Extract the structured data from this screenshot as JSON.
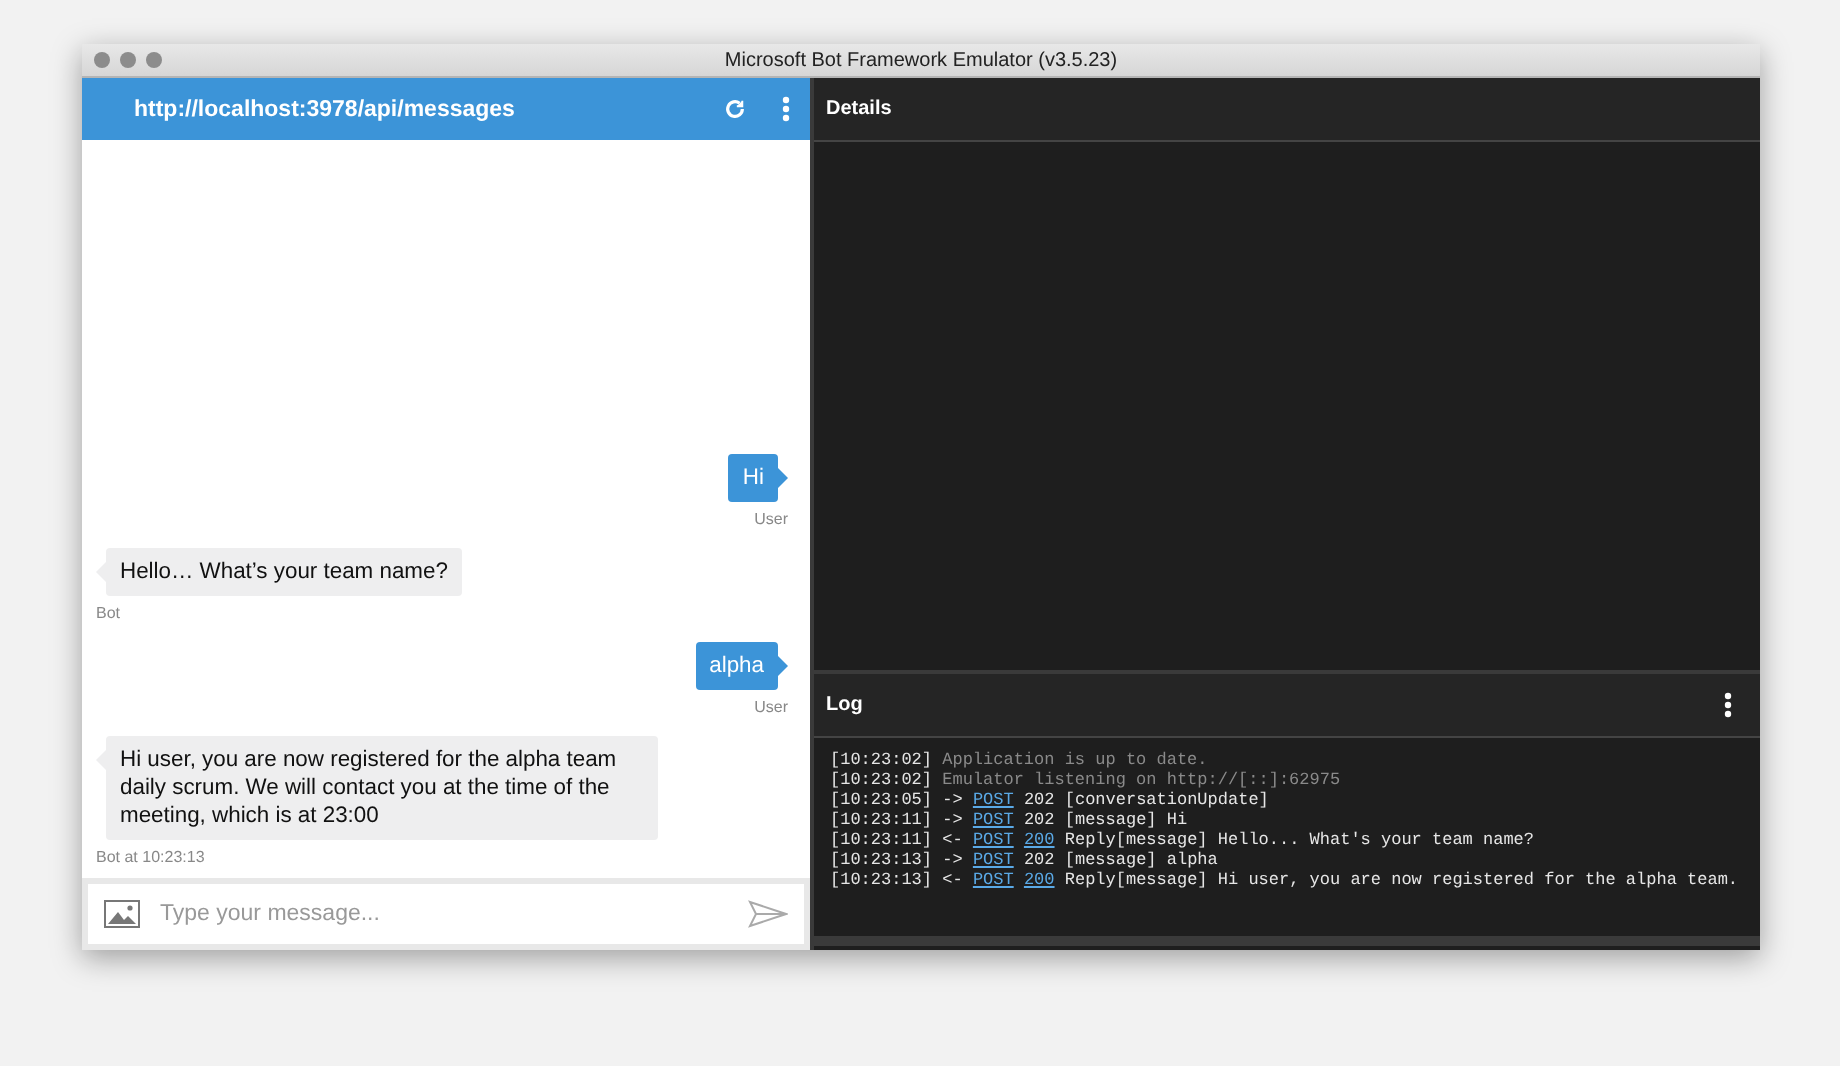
{
  "window": {
    "title": "Microsoft Bot Framework Emulator (v3.5.23)"
  },
  "chat": {
    "address": "http://localhost:3978/api/messages",
    "messages": [
      {
        "kind": "user",
        "text": "Hi",
        "caption": "User"
      },
      {
        "kind": "bot",
        "text": "Hello… What’s your team name?",
        "caption": "Bot"
      },
      {
        "kind": "user",
        "text": "alpha",
        "caption": "User"
      },
      {
        "kind": "bot",
        "text": "Hi user, you are now registered for the alpha team daily scrum. We will contact you at the time of the meeting, which is at 23:00",
        "caption": "Bot at 10:23:13"
      }
    ],
    "input": {
      "placeholder": "Type your message..."
    }
  },
  "details": {
    "title": "Details"
  },
  "log": {
    "title": "Log",
    "lines": [
      {
        "kind": "info",
        "time": "[10:23:02]",
        "text": "Application is up to date."
      },
      {
        "kind": "info",
        "time": "[10:23:02]",
        "text": "Emulator listening on http://[::]:62975"
      },
      {
        "kind": "traffic",
        "time": "[10:23:05]",
        "direction": "->",
        "method": "POST",
        "status": "202",
        "status_link": false,
        "text": "[conversationUpdate]"
      },
      {
        "kind": "traffic",
        "time": "[10:23:11]",
        "direction": "->",
        "method": "POST",
        "status": "202",
        "status_link": false,
        "text": "[message] Hi"
      },
      {
        "kind": "traffic",
        "time": "[10:23:11]",
        "direction": "<-",
        "method": "POST",
        "status": "200",
        "status_link": true,
        "text": "Reply[message] Hello... What's your team name?"
      },
      {
        "kind": "traffic",
        "time": "[10:23:13]",
        "direction": "->",
        "method": "POST",
        "status": "202",
        "status_link": false,
        "text": "[message] alpha"
      },
      {
        "kind": "traffic",
        "time": "[10:23:13]",
        "direction": "<-",
        "method": "POST",
        "status": "200",
        "status_link": true,
        "text": "Reply[message] Hi user, you are now registered for the alpha team."
      }
    ]
  }
}
